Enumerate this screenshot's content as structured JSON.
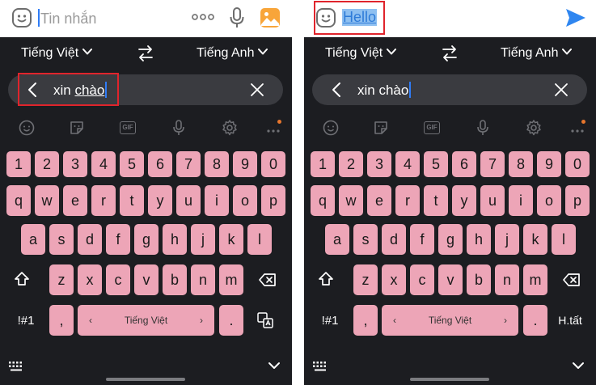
{
  "left": {
    "message_placeholder": "Tin nhắn",
    "lang_from": "Tiếng Việt",
    "lang_to": "Tiếng Anh",
    "translate_text_plain": "xin ",
    "translate_text_underlined": "chào",
    "space_label": "Tiếng Việt",
    "symbols_label": "!#1"
  },
  "right": {
    "typed_text": "Hello",
    "lang_from": "Tiếng Việt",
    "lang_to": "Tiếng Anh",
    "translate_text": "xin chào",
    "space_label": "Tiếng Việt",
    "symbols_label": "!#1",
    "action_label": "H.tất"
  },
  "keyboard": {
    "row1": [
      "1",
      "2",
      "3",
      "4",
      "5",
      "6",
      "7",
      "8",
      "9",
      "0"
    ],
    "row2": [
      "q",
      "w",
      "e",
      "r",
      "t",
      "y",
      "u",
      "i",
      "o",
      "p"
    ],
    "row3": [
      "a",
      "s",
      "d",
      "f",
      "g",
      "h",
      "j",
      "k",
      "l"
    ],
    "row4": [
      "z",
      "x",
      "c",
      "v",
      "b",
      "n",
      "m"
    ],
    "comma": ",",
    "period": ".",
    "arrow_left": "‹",
    "arrow_right": "›"
  },
  "colors": {
    "key_pink": "#eda5b7",
    "keyboard_bg": "#1c1d21",
    "highlight_red": "#e0242c",
    "accent_blue": "#2f7cf6"
  },
  "icons": {
    "emoji": "smiley-icon",
    "more": "dots-icon",
    "voice": "mic-icon",
    "gallery": "image-icon",
    "send": "send-icon",
    "swap": "swap-icon",
    "back": "back-icon",
    "clear": "clear-icon",
    "shift": "shift-icon",
    "backspace": "backspace-icon",
    "translate": "translate-icon",
    "keyboard": "keyboard-icon",
    "collapse": "chevron-down-icon"
  }
}
